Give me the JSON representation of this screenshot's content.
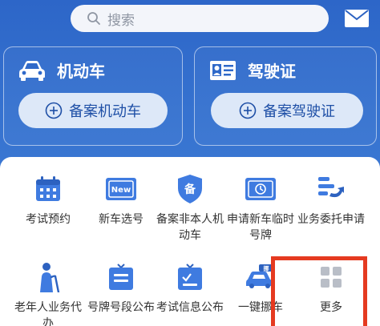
{
  "search": {
    "placeholder": "搜索"
  },
  "cards": {
    "vehicle": {
      "title": "机动车",
      "button": "备案机动车"
    },
    "license": {
      "title": "驾驶证",
      "button": "备案驾驶证"
    }
  },
  "services": [
    {
      "label": "考试预约",
      "icon": "calendar-icon"
    },
    {
      "label": "新车选号",
      "icon": "new-plate-icon"
    },
    {
      "label": "备案非本人机动车",
      "icon": "shield-record-icon"
    },
    {
      "label": "申请新车临时号牌",
      "icon": "temp-plate-icon"
    },
    {
      "label": "业务委托申请",
      "icon": "entrust-icon"
    },
    {
      "label": "老年人业务代办",
      "icon": "elderly-icon"
    },
    {
      "label": "号牌号段公布",
      "icon": "plate-segment-icon"
    },
    {
      "label": "考试信息公布",
      "icon": "exam-info-icon"
    },
    {
      "label": "一键挪车",
      "icon": "move-car-icon"
    },
    {
      "label": "更多",
      "icon": "more-grid-icon"
    }
  ],
  "colors": {
    "primary": "#2c62c1",
    "accent": "#3f7be0",
    "highlight": "#e53a20"
  }
}
